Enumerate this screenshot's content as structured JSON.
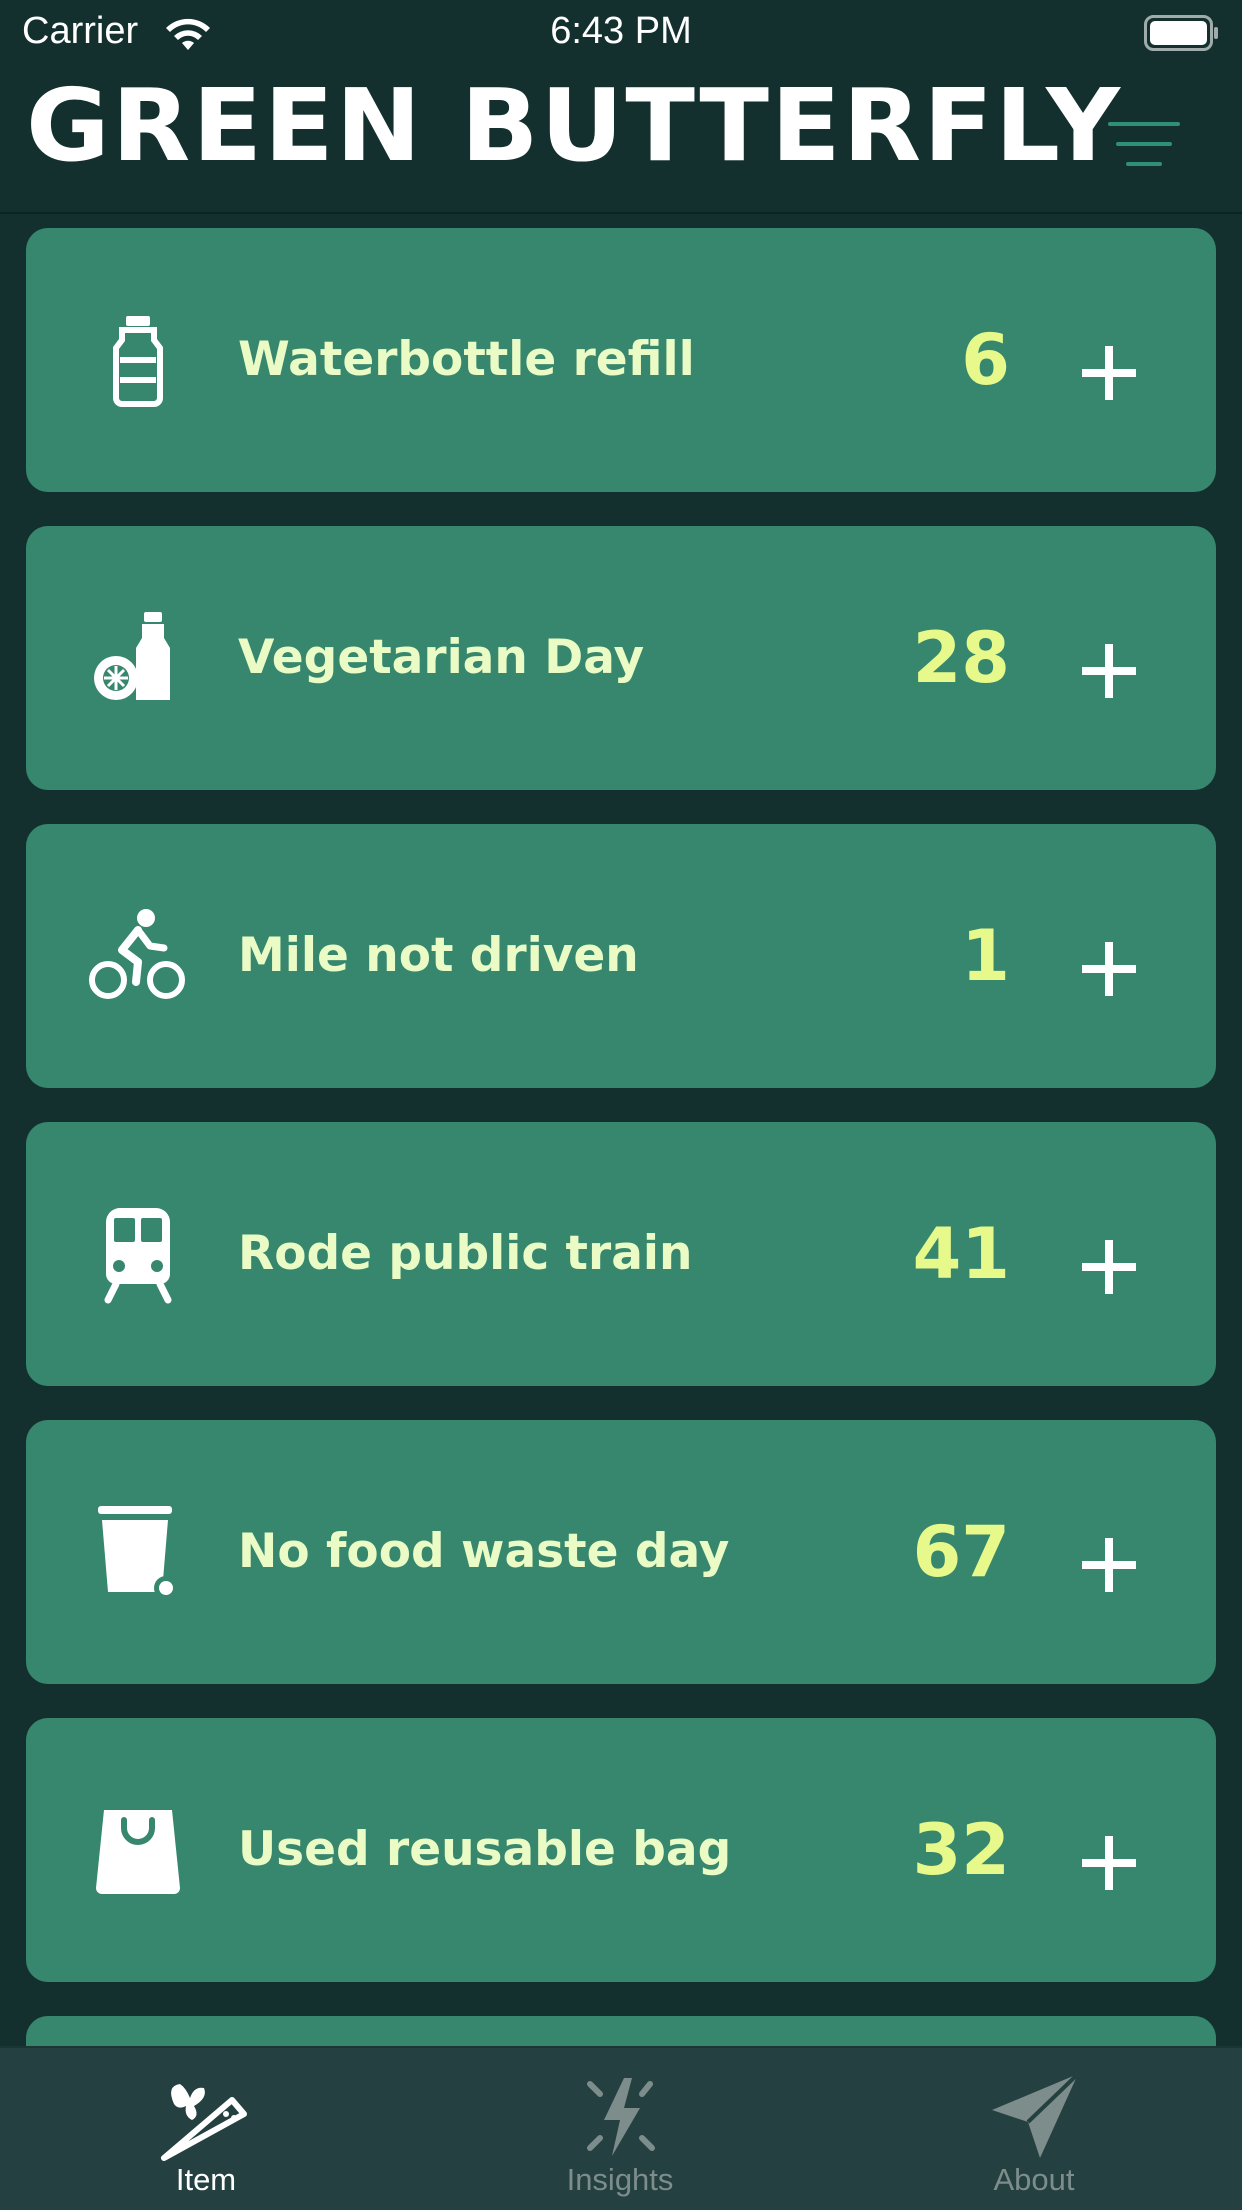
{
  "status_bar": {
    "carrier": "Carrier",
    "time": "6:43 PM"
  },
  "header": {
    "title": "GREEN BUTTERFLY",
    "menu_icon": "hamburger-menu-icon"
  },
  "items": [
    {
      "label": "Waterbottle refill",
      "count": "6",
      "icon": "water-bottle-icon"
    },
    {
      "label": "Vegetarian Day",
      "count": "28",
      "icon": "vegetarian-food-icon"
    },
    {
      "label": "Mile not driven",
      "count": "1",
      "icon": "cyclist-icon"
    },
    {
      "label": "Rode public train",
      "count": "41",
      "icon": "train-icon"
    },
    {
      "label": "No food waste day",
      "count": "67",
      "icon": "trash-bin-icon"
    },
    {
      "label": "Used reusable bag",
      "count": "32",
      "icon": "shopping-bag-icon"
    }
  ],
  "tabs": [
    {
      "label": "Item",
      "icon": "butterfly-pencil-icon",
      "active": true
    },
    {
      "label": "Insights",
      "icon": "lightning-icon",
      "active": false
    },
    {
      "label": "About",
      "icon": "paper-plane-icon",
      "active": false
    }
  ],
  "colors": {
    "background": "#13302f",
    "card": "#36876e",
    "label_text": "#eafbc5",
    "count_text": "#e6f98a",
    "tab_bar": "#244040",
    "menu_accent": "#2f8f78"
  }
}
